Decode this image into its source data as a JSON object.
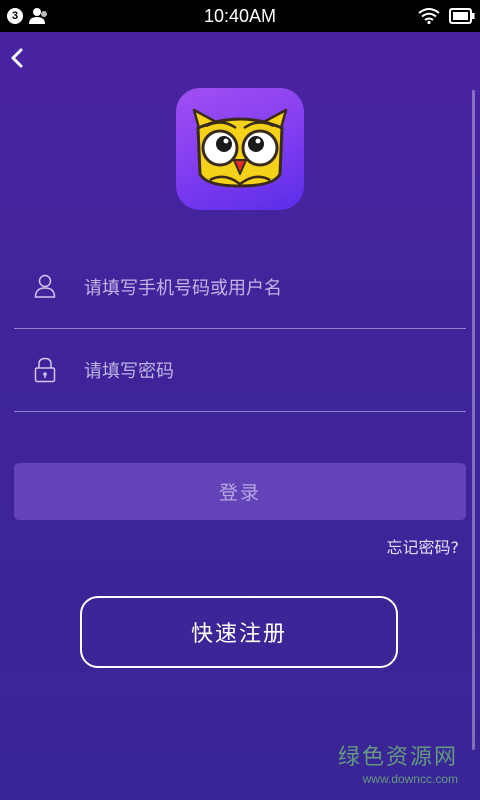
{
  "status_bar": {
    "notification_count": "3",
    "time": "10:40AM",
    "icons": [
      "user-icon",
      "wifi-icon",
      "battery-icon"
    ]
  },
  "nav": {
    "back_icon": "chevron-left-icon"
  },
  "logo": {
    "icon": "owl-logo-icon"
  },
  "form": {
    "username_placeholder": "请填写手机号码或用户名",
    "password_placeholder": "请填写密码",
    "username_icon": "user-outline-icon",
    "password_icon": "lock-icon"
  },
  "actions": {
    "login_label": "登录",
    "forgot_password_label": "忘记密码?",
    "register_label": "快速注册"
  },
  "watermark": {
    "title": "绿色资源网",
    "url": "www.downcc.com"
  },
  "colors": {
    "background": "#4a23a3",
    "login_button": "#6343b8",
    "logo_gradient_top": "#a24ff2",
    "logo_gradient_bottom": "#5a2de8",
    "owl_yellow": "#f5d21a",
    "owl_beak": "#e0322b",
    "watermark_green": "#70c078"
  }
}
